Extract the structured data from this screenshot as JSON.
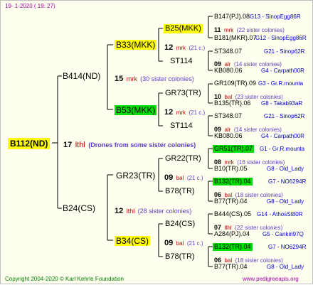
{
  "header": {
    "date": "19-  1-2020 ( 19: 27)"
  },
  "root": {
    "name": "B112(ND)",
    "count": "17",
    "mark": "lthl",
    "note": "(Drones from some sister colonies)"
  },
  "gen1": {
    "sire": {
      "name": "B414(ND)",
      "count": "15",
      "mark": "mrk",
      "note": "(30 sister colonies)"
    },
    "dam": {
      "name": "B24(CS)",
      "count": "12",
      "mark": "lthl",
      "note": "(28 sister colonies)"
    }
  },
  "gen2": {
    "s1": {
      "name": "B33(MKK)",
      "count": "12",
      "mark": "mrk",
      "note": "(21 c.)"
    },
    "s2": {
      "name": "B53(MKK)",
      "count": "12",
      "mark": "mrk",
      "note": "(21 c.)"
    },
    "d1": {
      "name": "GR23(TR)",
      "count": "09",
      "mark": "bal",
      "note": "(21 c.)"
    },
    "d2": {
      "name": "B34(CS)",
      "count": "09",
      "mark": "bal",
      "note": "(21 c.)"
    }
  },
  "gen3": {
    "a": "B25(MKK)",
    "b": "ST114",
    "c": "GR73(TR)",
    "d": "ST114",
    "e": "GR22(TR)",
    "f": "B78(TR)",
    "g": "B24(CS)",
    "h": "B78(TR)"
  },
  "gen4": [
    {
      "top_code": "B147(PJ).08",
      "top_info": "G13 - SinopEgg86R",
      "count": "11",
      "mark": "mrk",
      "note": "(22 sister colonies)",
      "bot_code": "B181(MKR).07",
      "bot_info": "G12 - SinopEgg86R"
    },
    {
      "top_code": "ST348.07",
      "top_info": "G21 - Sinop62R",
      "count": "09",
      "mark": "alr",
      "note": "(14 sister colonies)",
      "bot_code": "KB080.06",
      "bot_info": "G4 - Carpath00R"
    },
    {
      "top_code": "GR109(TR).09",
      "top_info": "G3 - Gr.R.mounta",
      "count": "10",
      "mark": "bal",
      "note": "(23 sister colonies)",
      "bot_code": "B135(TR).06",
      "bot_info": "G8 - Takab93aR"
    },
    {
      "top_code": "ST348.07",
      "top_info": "G21 - Sinop62R",
      "count": "09",
      "mark": "alr",
      "note": "(14 sister colonies)",
      "bot_code": "KB080.06",
      "bot_info": "G4 - Carpath00R"
    },
    {
      "top_code": "GR51(TR).07",
      "top_info": "G1 - Gr.R.mounta",
      "count": "08",
      "mark": "mrk",
      "note": "(16 sister colonies)",
      "bot_code": "B10(TR).05",
      "bot_info": "G8 - Old_Lady"
    },
    {
      "top_code": "B132(TR).04",
      "top_info": "G7 - NO6294R",
      "count": "06",
      "mark": "bal",
      "note": "(18 sister colonies)",
      "bot_code": "B77(TR).04",
      "bot_info": "G8 - Old_Lady"
    },
    {
      "top_code": "B444(CS).05",
      "top_info": "G14 - AthosSt80R",
      "count": "07",
      "mark": "lthl",
      "note": "(22 sister colonies)",
      "bot_code": "A284(PJ).04",
      "bot_info": "G5 - Cankiri97Q"
    },
    {
      "top_code": "B132(TR).04",
      "top_info": "G7 - NO6294R",
      "count": "06",
      "mark": "bal",
      "note": "(18 sister colonies)",
      "bot_code": "B77(TR).04",
      "bot_info": "G8 - Old_Lady"
    }
  ],
  "footer": {
    "copyright": "Copyright 2004-2020 © Karl Kehrle Foundation",
    "url": "www.pedigreeapis.org"
  },
  "colors": {
    "highlight_yellow": "#ffff00",
    "highlight_green": "#00dd00",
    "line": "#000000"
  }
}
